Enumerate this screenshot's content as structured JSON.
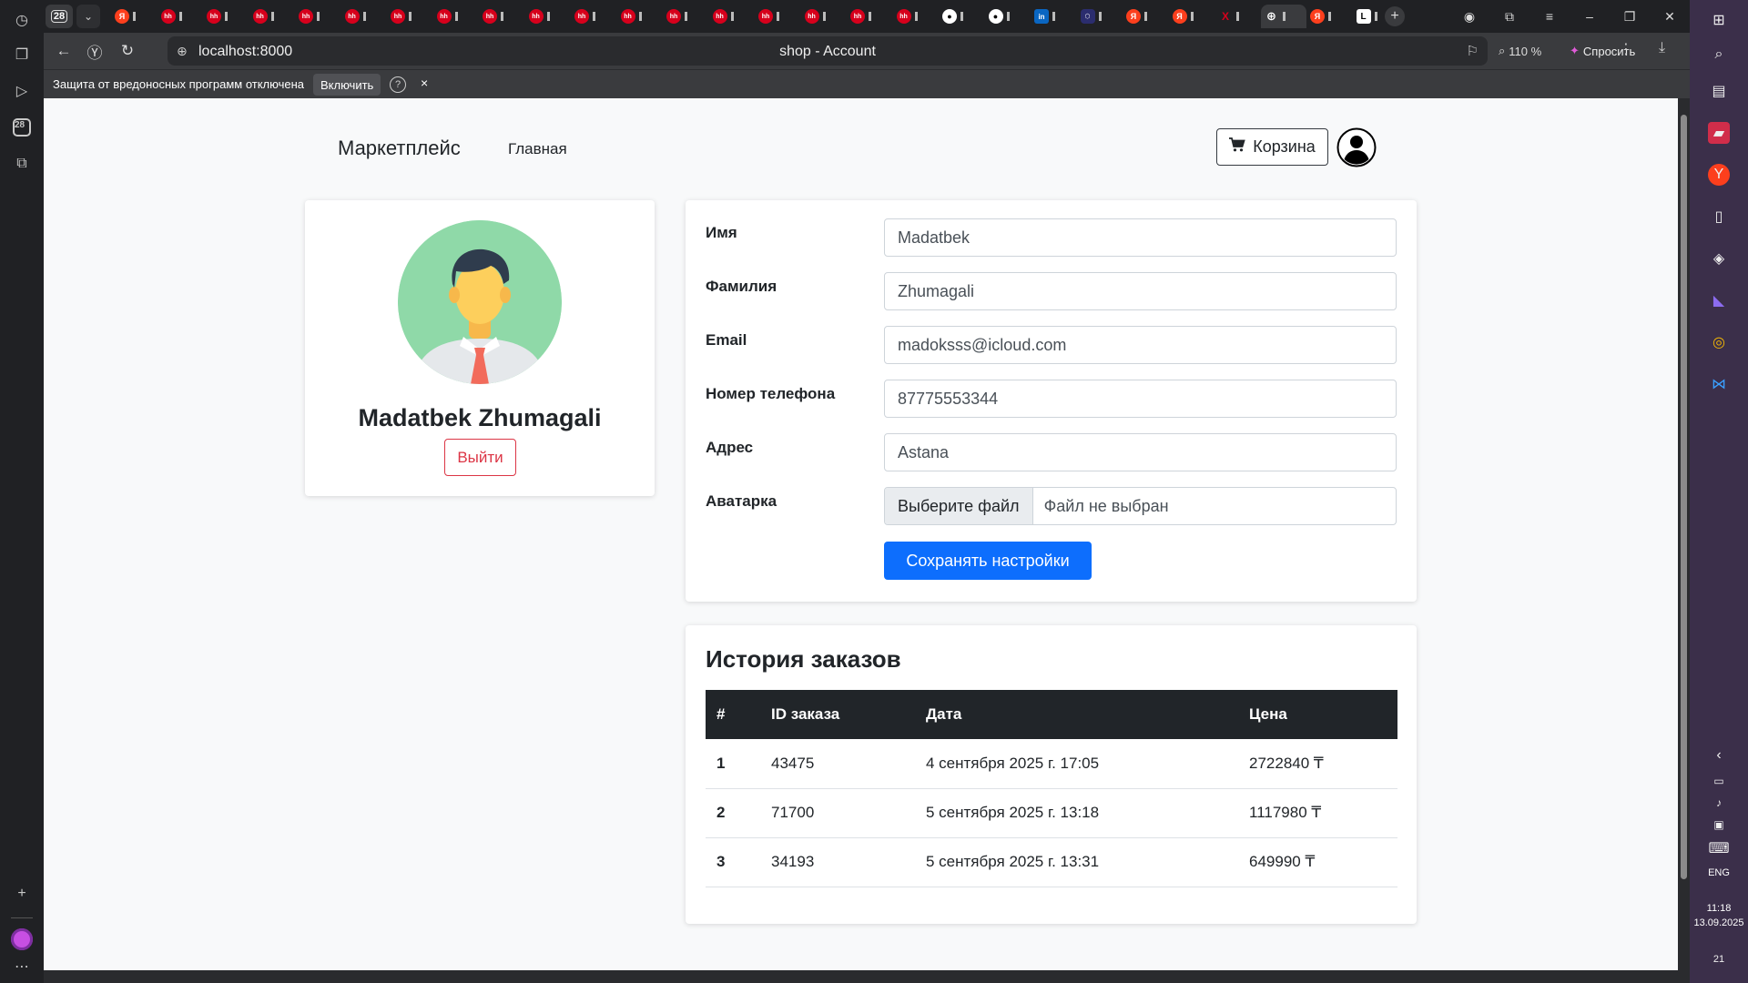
{
  "browser": {
    "tab_counter": "28",
    "left_rail_badge": "28",
    "url": "localhost:8000",
    "page_title": "shop - Account",
    "zoom": "110 %",
    "ask_label": "Спросить",
    "infobar": {
      "text": "Защита от вредоносных программ отключена",
      "enable_label": "Включить",
      "help": "?",
      "close": "×"
    }
  },
  "tabs": [
    {
      "icon": "ya",
      "glyph": "Я"
    },
    {
      "icon": "hh",
      "glyph": "hh"
    },
    {
      "icon": "hh",
      "glyph": "hh"
    },
    {
      "icon": "hh",
      "glyph": "hh"
    },
    {
      "icon": "hh",
      "glyph": "hh"
    },
    {
      "icon": "hh",
      "glyph": "hh"
    },
    {
      "icon": "hh",
      "glyph": "hh"
    },
    {
      "icon": "hh",
      "glyph": "hh"
    },
    {
      "icon": "hh",
      "glyph": "hh"
    },
    {
      "icon": "hh",
      "glyph": "hh"
    },
    {
      "icon": "hh",
      "glyph": "hh"
    },
    {
      "icon": "hh",
      "glyph": "hh"
    },
    {
      "icon": "hh",
      "glyph": "hh"
    },
    {
      "icon": "hh",
      "glyph": "hh"
    },
    {
      "icon": "hh",
      "glyph": "hh"
    },
    {
      "icon": "hh",
      "glyph": "hh"
    },
    {
      "icon": "hh",
      "glyph": "hh"
    },
    {
      "icon": "hh",
      "glyph": "hh"
    },
    {
      "icon": "gh",
      "glyph": "●"
    },
    {
      "icon": "gh",
      "glyph": "●"
    },
    {
      "icon": "li",
      "glyph": "in"
    },
    {
      "icon": "hex",
      "glyph": "⬡"
    },
    {
      "icon": "ya",
      "glyph": "Я"
    },
    {
      "icon": "ya",
      "glyph": "Я"
    },
    {
      "icon": "x",
      "glyph": "X"
    },
    {
      "icon": "globe",
      "glyph": "⊕",
      "active": true
    },
    {
      "icon": "ya",
      "glyph": "Я"
    },
    {
      "icon": "l",
      "glyph": "L"
    }
  ],
  "clock": {
    "time": "11:18",
    "date": "13.09.2025",
    "lang": "ENG",
    "notifications": "21"
  },
  "site": {
    "brand": "Маркетплейс",
    "nav_home": "Главная",
    "cart_label": "Корзина"
  },
  "profile": {
    "name": "Madatbek Zhumagali",
    "logout_label": "Выйти"
  },
  "form": {
    "first_name_label": "Имя",
    "first_name": "Madatbek",
    "last_name_label": "Фамилия",
    "last_name": "Zhumagali",
    "email_label": "Email",
    "email": "madoksss@icloud.com",
    "phone_label": "Номер телефона",
    "phone": "87775553344",
    "address_label": "Адрес",
    "address": "Astana",
    "avatar_label": "Аватарка",
    "file_button": "Выберите файл",
    "file_none": "Файл не выбран",
    "save_label": "Сохранять настройки"
  },
  "orders": {
    "title": "История заказов",
    "headers": [
      "#",
      "ID заказа",
      "Дата",
      "Цена"
    ],
    "rows": [
      {
        "n": "1",
        "id": "43475",
        "date": "4 сентября 2025 г. 17:05",
        "price": "2722840 ₸"
      },
      {
        "n": "2",
        "id": "71700",
        "date": "5 сентября 2025 г. 13:18",
        "price": "1117980 ₸"
      },
      {
        "n": "3",
        "id": "34193",
        "date": "5 сентября 2025 г. 13:31",
        "price": "649990 ₸"
      }
    ]
  },
  "colors": {
    "primary": "#0d6efd",
    "danger": "#dc3545",
    "table_header": "#212529",
    "avatar_bg": "#8fd9a8"
  }
}
